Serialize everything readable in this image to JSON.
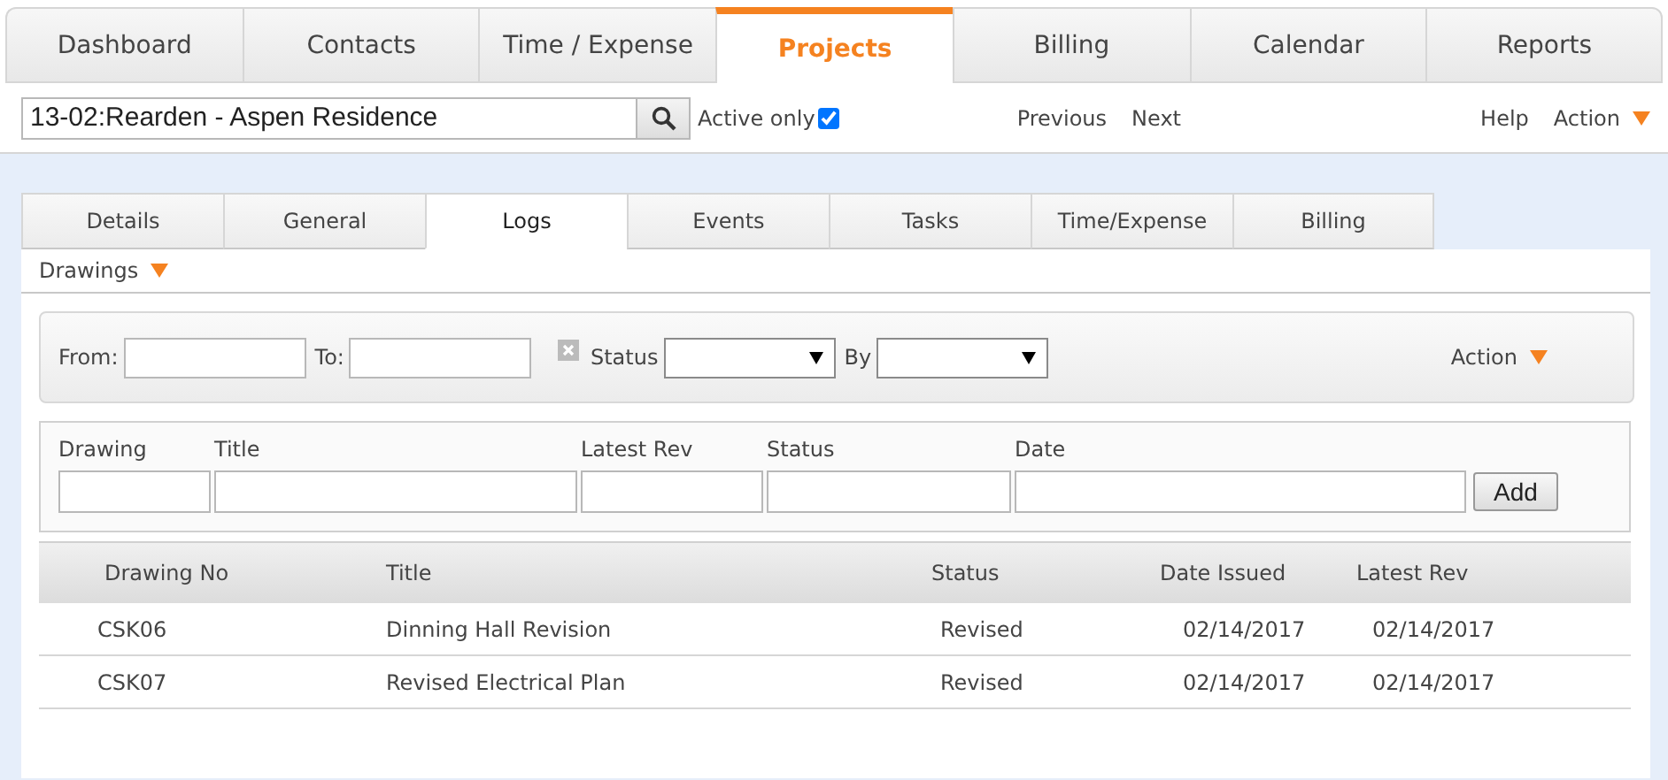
{
  "nav_tabs": [
    {
      "label": "Dashboard",
      "selected": false
    },
    {
      "label": "Contacts",
      "selected": false
    },
    {
      "label": "Time / Expense",
      "selected": false
    },
    {
      "label": "Projects",
      "selected": true
    },
    {
      "label": "Billing",
      "selected": false
    },
    {
      "label": "Calendar",
      "selected": false
    },
    {
      "label": "Reports",
      "selected": false
    }
  ],
  "project_search": {
    "value": "13-02:Rearden - Aspen Residence"
  },
  "active_only": {
    "label": "Active only",
    "checked": true
  },
  "pager": [
    "Previous",
    "Next"
  ],
  "menu": {
    "help": "Help",
    "action": "Action"
  },
  "sub_tabs": [
    {
      "label": "Details",
      "selected": false
    },
    {
      "label": "General",
      "selected": false
    },
    {
      "label": "Logs",
      "selected": true
    },
    {
      "label": "Events",
      "selected": false
    },
    {
      "label": "Tasks",
      "selected": false
    },
    {
      "label": "Time/Expense",
      "selected": false
    },
    {
      "label": "Billing",
      "selected": false
    }
  ],
  "section": "Drawings",
  "filter": {
    "from_label": "From:",
    "to_label": "To:",
    "status_label": "Status",
    "by_label": "By",
    "action": "Action"
  },
  "add_form": {
    "fields": [
      "Drawing",
      "Title",
      "Latest Rev",
      "Status",
      "Date"
    ],
    "button": "Add"
  },
  "table": {
    "columns": [
      "Drawing No",
      "Title",
      "Status",
      "Date Issued",
      "Latest Rev"
    ],
    "rows": [
      [
        "CSK06",
        "Dinning Hall Revision",
        "Revised",
        "02/14/2017",
        "02/14/2017"
      ],
      [
        "CSK07",
        "Revised Electrical Plan",
        "Revised",
        "02/14/2017",
        "02/14/2017"
      ]
    ]
  }
}
